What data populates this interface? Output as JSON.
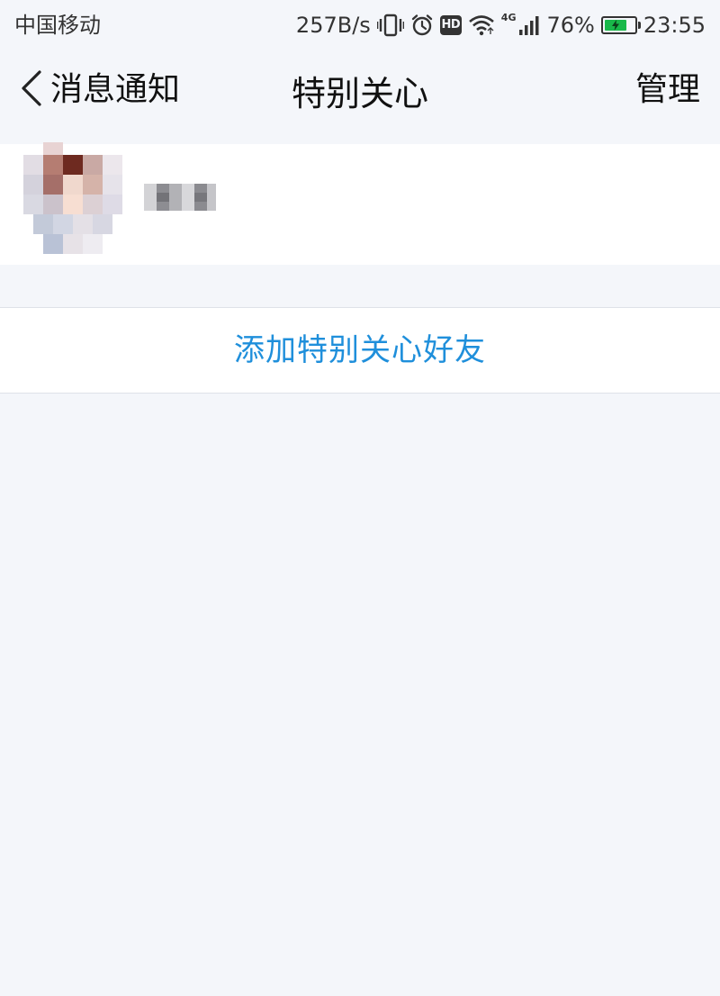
{
  "status_bar": {
    "carrier": "中国移动",
    "net_speed": "257B/s",
    "hd_badge": "HD",
    "network_type": "4G",
    "battery_percent": "76%",
    "battery_level": 0.76,
    "time": "23:55",
    "icons": [
      "vibrate-icon",
      "alarm-icon",
      "hd-icon",
      "wifi-icon",
      "signal-icon",
      "battery-icon"
    ]
  },
  "nav": {
    "back_label": "消息通知",
    "title": "特别关心",
    "action_label": "管理"
  },
  "friends": [
    {
      "name": "",
      "avatar": "pixelated-avatar",
      "name_obscured": true
    }
  ],
  "add_button": {
    "label": "添加特别关心好友"
  },
  "colors": {
    "background": "#f4f6fa",
    "card": "#ffffff",
    "accent": "#1f8fdb",
    "battery": "#19b84a",
    "text": "#111111"
  }
}
